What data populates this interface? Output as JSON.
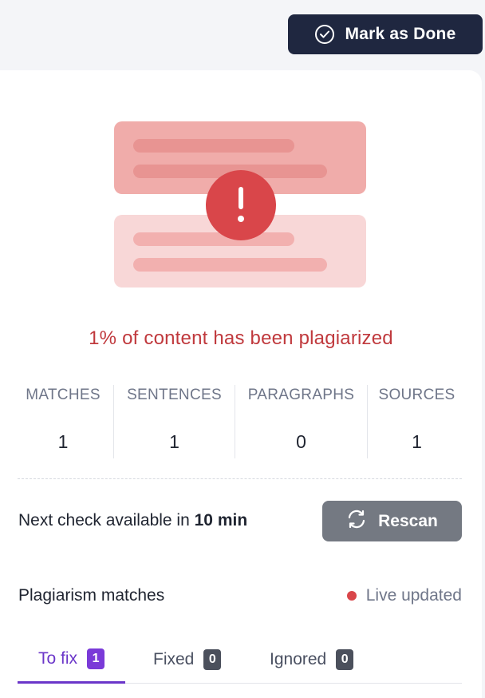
{
  "header": {
    "mark_done_label": "Mark as Done"
  },
  "result": {
    "summary": "1% of content has been plagiarized"
  },
  "stats": [
    {
      "label": "MATCHES",
      "value": "1"
    },
    {
      "label": "SENTENCES",
      "value": "1"
    },
    {
      "label": "PARAGRAPHS",
      "value": "0"
    },
    {
      "label": "SOURCES",
      "value": "1"
    }
  ],
  "next_check": {
    "prefix": "Next check available in ",
    "time": "10 min"
  },
  "rescan_label": "Rescan",
  "matches": {
    "title": "Plagiarism matches",
    "live_label": "Live updated"
  },
  "tabs": [
    {
      "label": "To fix",
      "count": "1"
    },
    {
      "label": "Fixed",
      "count": "0"
    },
    {
      "label": "Ignored",
      "count": "0"
    }
  ],
  "colors": {
    "accent": "#6b36c9",
    "alert": "#d9464a",
    "dark_button": "#1f2740",
    "rescan_button": "#747982"
  }
}
